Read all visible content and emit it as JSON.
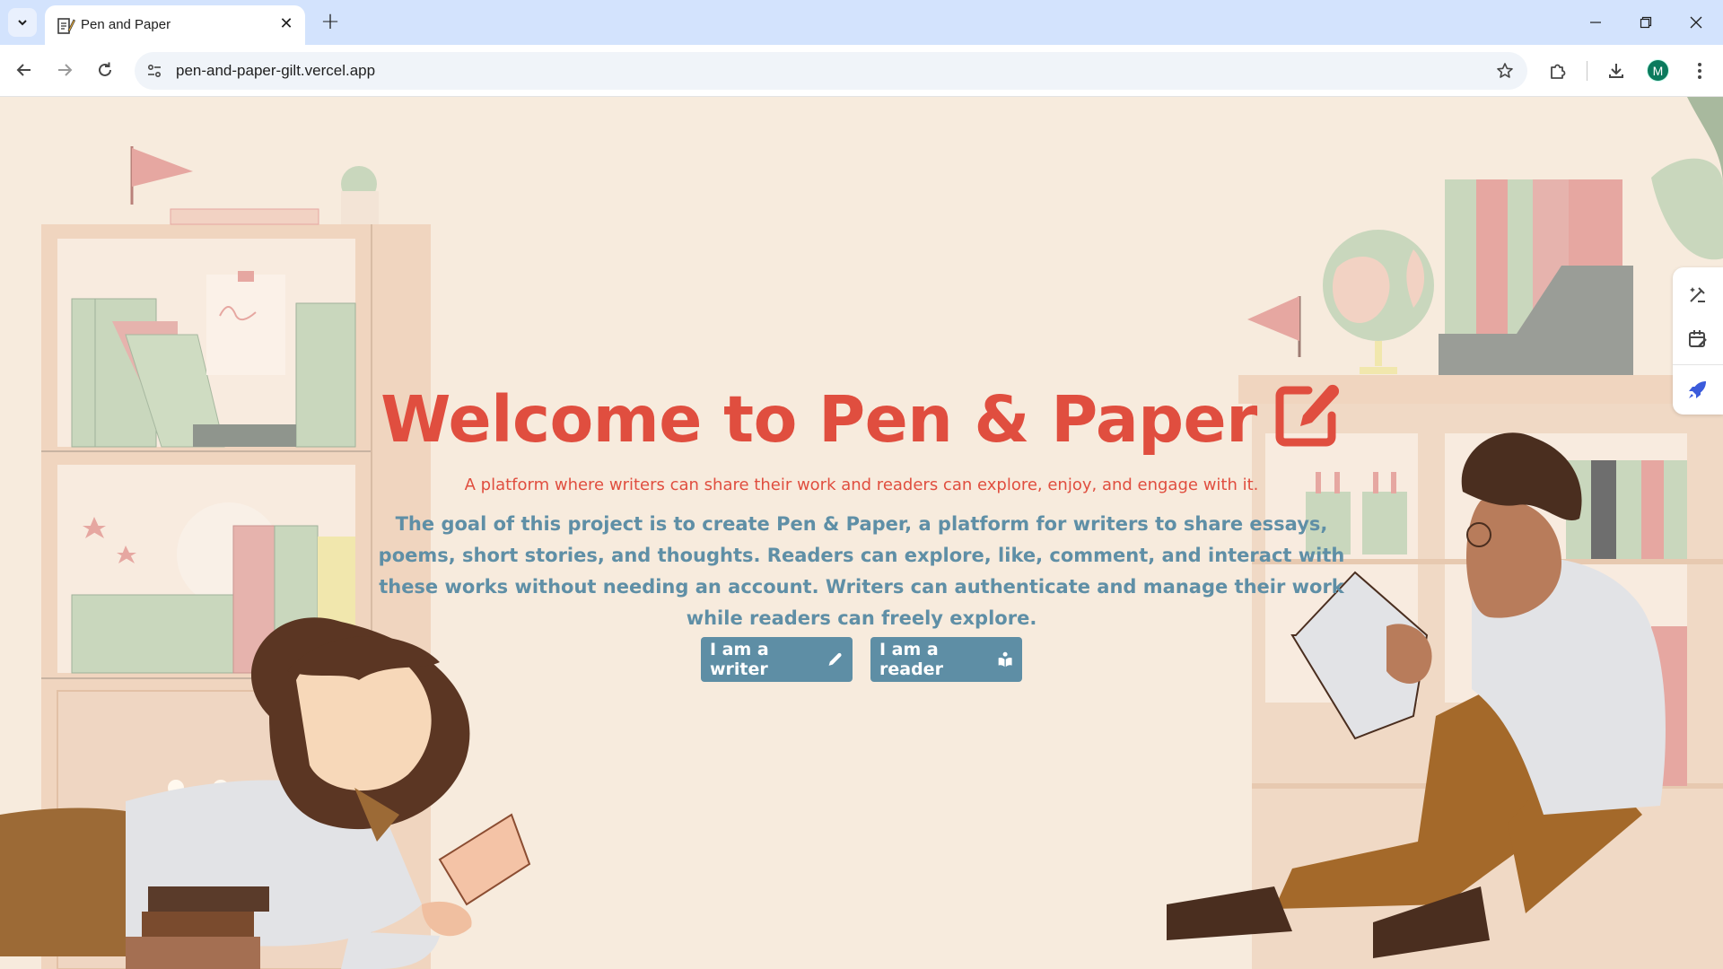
{
  "browser": {
    "tab_title": "Pen and Paper",
    "url": "pen-and-paper-gilt.vercel.app",
    "profile_initial": "M"
  },
  "hero": {
    "title": "Welcome to Pen & Paper",
    "tagline": "A platform where writers can share their work and readers can explore, enjoy, and engage with it.",
    "description": "The goal of this project is to create Pen & Paper, a platform for writers to share essays, poems, short stories, and thoughts. Readers can explore, like, comment, and interact with these works without needing an account. Writers can authenticate and manage their work while readers can freely explore.",
    "writer_button": "I am a writer",
    "reader_button": "I am a reader"
  },
  "colors": {
    "background": "#f7ebdd",
    "title": "#e04e3f",
    "description": "#5f8fa6",
    "button": "#5e8ea5"
  },
  "icons": {
    "title_icon": "pen-to-square-icon",
    "writer_icon": "pencil-icon",
    "reader_icon": "book-reader-icon"
  }
}
